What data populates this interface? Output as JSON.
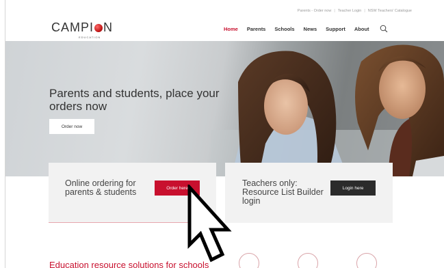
{
  "utility_links": [
    "Parents - Order now",
    "Teacher Login",
    "NSW Teachers' Catalogue"
  ],
  "logo": {
    "text_left": "CAMPI",
    "text_right": "N",
    "subtitle": "EDUCATION"
  },
  "nav": {
    "items": [
      {
        "label": "Home",
        "active": true
      },
      {
        "label": "Parents",
        "active": false
      },
      {
        "label": "Schools",
        "active": false
      },
      {
        "label": "News",
        "active": false
      },
      {
        "label": "Support",
        "active": false
      },
      {
        "label": "About",
        "active": false
      }
    ],
    "search_icon": "search-icon"
  },
  "hero": {
    "title": "Parents and students, place your orders now",
    "button_label": "Order now"
  },
  "cards": {
    "parents": {
      "title": "Online ordering for parents & students",
      "button_label": "Order here"
    },
    "teachers": {
      "title": "Teachers only: Resource List Builder login",
      "button_label": "Login here"
    }
  },
  "solutions": {
    "heading": "Education resource solutions for schools"
  },
  "colors": {
    "accent": "#c8102e",
    "dark_button": "#2b2b2b",
    "card_bg": "#f2f2f2"
  }
}
